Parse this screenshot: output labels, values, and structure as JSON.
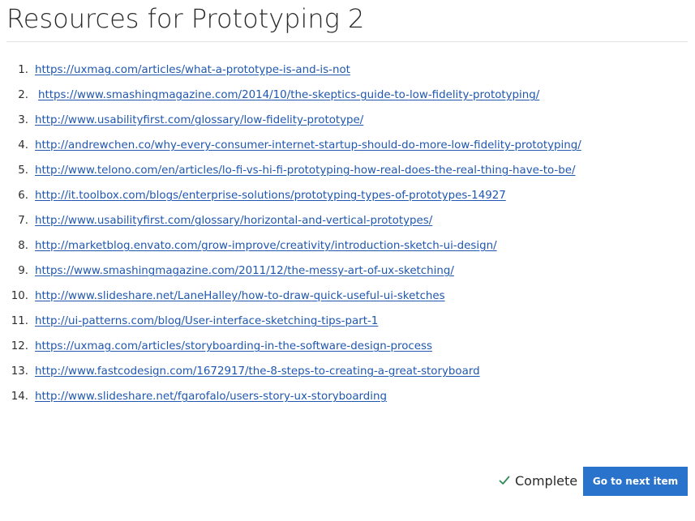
{
  "page": {
    "title": "Resources for Prototyping 2"
  },
  "resources": [
    {
      "number": "1.",
      "url": "https://uxmag.com/articles/what-a-prototype-is-and-is-not"
    },
    {
      "number": "2.",
      "url": "https://www.smashingmagazine.com/2014/10/the-skeptics-guide-to-low-fidelity-prototyping/"
    },
    {
      "number": "3.",
      "url": "http://www.usabilityfirst.com/glossary/low-fidelity-prototype/"
    },
    {
      "number": "4.",
      "url": "http://andrewchen.co/why-every-consumer-internet-startup-should-do-more-low-fidelity-prototyping/"
    },
    {
      "number": "5.",
      "url": "http://www.telono.com/en/articles/lo-fi-vs-hi-fi-prototyping-how-real-does-the-real-thing-have-to-be/"
    },
    {
      "number": "6.",
      "url": "http://it.toolbox.com/blogs/enterprise-solutions/prototyping-types-of-prototypes-14927"
    },
    {
      "number": "7.",
      "url": "http://www.usabilityfirst.com/glossary/horizontal-and-vertical-prototypes/"
    },
    {
      "number": "8.",
      "url": "http://marketblog.envato.com/grow-improve/creativity/introduction-sketch-ui-design/"
    },
    {
      "number": "9.",
      "url": "https://www.smashingmagazine.com/2011/12/the-messy-art-of-ux-sketching/"
    },
    {
      "number": "10.",
      "url": "http://www.slideshare.net/LaneHalley/how-to-draw-quick-useful-ui-sketches"
    },
    {
      "number": "11.",
      "url": "http://ui-patterns.com/blog/User-interface-sketching-tips-part-1"
    },
    {
      "number": "12.",
      "url": "https://uxmag.com/articles/storyboarding-in-the-software-design-process"
    },
    {
      "number": "13.",
      "url": "http://www.fastcodesign.com/1672917/the-8-steps-to-creating-a-great-storyboard"
    },
    {
      "number": "14.",
      "url": "http://www.slideshare.net/fgarofalo/users-story-ux-storyboarding"
    }
  ],
  "footer": {
    "complete_label": "Complete",
    "complete_icon": "check-icon",
    "next_button_label": "Go to next item"
  },
  "colors": {
    "link": "#1f57b0",
    "button_bg": "#2a73cc",
    "check": "#2e8b57"
  }
}
